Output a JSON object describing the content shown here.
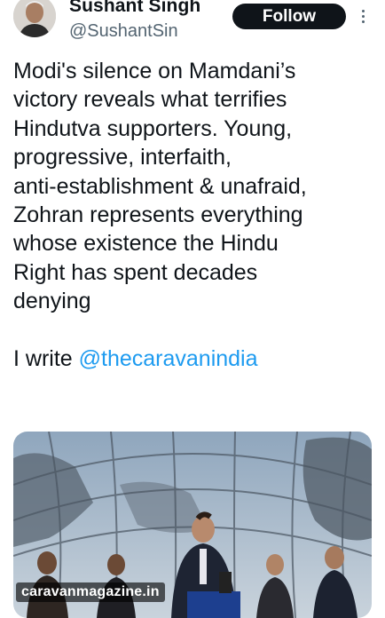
{
  "tweet": {
    "author_name": "Sushant Singh",
    "author_handle": "@SushantSin",
    "follow_label": "Follow",
    "body_lines": [
      "Modi's silence on Mamdani’s",
      "victory reveals what terrifies",
      "Hindutva supporters. Young,",
      "progressive, interfaith,",
      "anti-establishment & unafraid,",
      "Zohran represents everything",
      "whose existence the Hindu",
      "Right has spent decades",
      "denying"
    ],
    "write_prefix": "I write ",
    "mention": "@thecaravanindia",
    "media_caption": "caravanmagazine.in"
  },
  "icons": {
    "more": "more-vertical-icon"
  },
  "colors": {
    "follow_bg": "#0f1419",
    "mention": "#1d9bf0",
    "secondary_text": "#536471"
  }
}
